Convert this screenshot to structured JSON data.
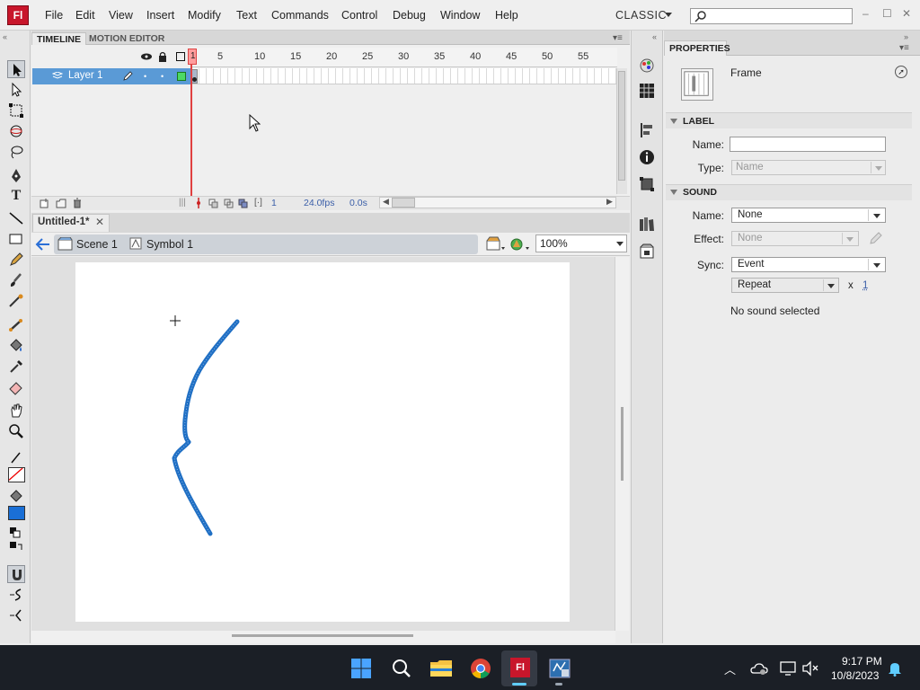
{
  "app": {
    "logo": "Fl",
    "menu": [
      "File",
      "Edit",
      "View",
      "Insert",
      "Modify",
      "Text",
      "Commands",
      "Control",
      "Debug",
      "Window",
      "Help"
    ],
    "workspace": "CLASSIC",
    "window_buttons": [
      "–",
      "☐",
      "✕"
    ]
  },
  "timeline": {
    "tabs": [
      "TIMELINE",
      "MOTION EDITOR"
    ],
    "frame_numbers": [
      "1",
      "5",
      "10",
      "15",
      "20",
      "25",
      "30",
      "35",
      "40",
      "45",
      "50",
      "55"
    ],
    "layer_name": "Layer 1",
    "current_frame": "1",
    "fps": "24.0fps",
    "time": "0.0s"
  },
  "document": {
    "tab_label": "Untitled-1*",
    "scene": "Scene 1",
    "symbol": "Symbol 1",
    "zoom": "100%"
  },
  "properties": {
    "tab": "PROPERTIES",
    "object_type": "Frame",
    "label_section": "LABEL",
    "name_label": "Name:",
    "name_value": "",
    "type_label": "Type:",
    "type_value": "Name",
    "sound_section": "SOUND",
    "sound_name_label": "Name:",
    "sound_name_value": "None",
    "effect_label": "Effect:",
    "effect_value": "None",
    "sync_label": "Sync:",
    "sync_value": "Event",
    "repeat_value": "Repeat",
    "repeat_x": "x",
    "repeat_count": "1",
    "status": "No sound selected"
  },
  "taskbar": {
    "time": "9:17 PM",
    "date": "10/8/2023"
  }
}
